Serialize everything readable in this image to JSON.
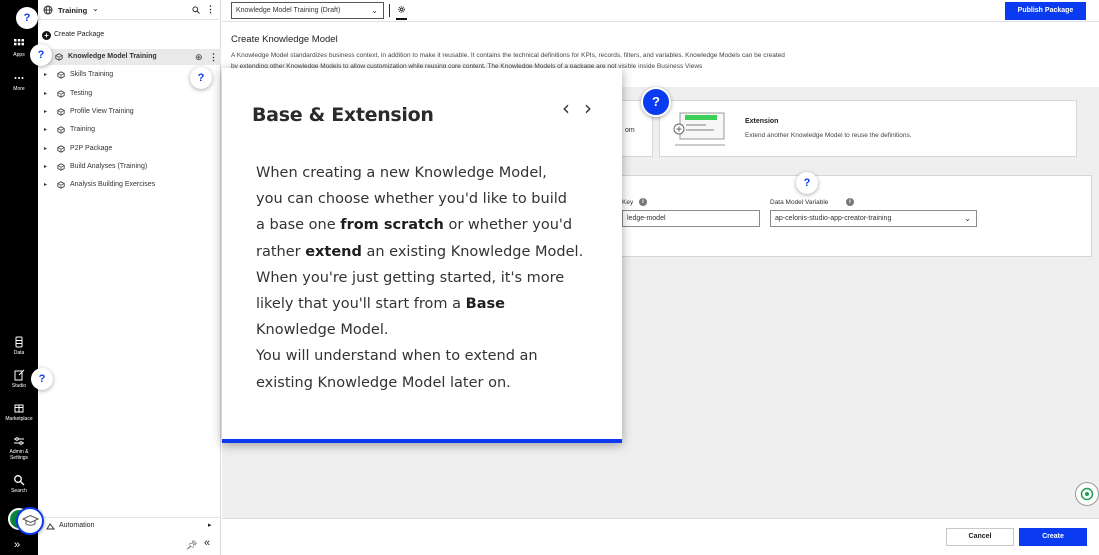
{
  "rail": {
    "items": [
      {
        "label": "Apps",
        "icon": "apps-grid-icon"
      },
      {
        "label": "More",
        "icon": "more-dots-icon"
      },
      {
        "label": "Data",
        "icon": "data-icon"
      },
      {
        "label": "Studio",
        "icon": "studio-icon"
      },
      {
        "label": "Marketplace",
        "icon": "marketplace-icon"
      },
      {
        "label": "Admin &",
        "label2": "Settings",
        "icon": "admin-settings-icon"
      },
      {
        "label": "Search",
        "icon": "search-icon"
      }
    ]
  },
  "sidebar": {
    "space_name": "Training",
    "create_package": "Create Package",
    "tree": [
      {
        "label": "Knowledge Model Training",
        "level": 1,
        "selected": true
      },
      {
        "label": "Skills Training",
        "level": 2
      },
      {
        "label": "Testing",
        "level": 2
      },
      {
        "label": "Profile View Training",
        "level": 2
      },
      {
        "label": "Training",
        "level": 2
      },
      {
        "label": "P2P Package",
        "level": 2
      },
      {
        "label": "Build Analyses (Training)",
        "level": 2
      },
      {
        "label": "Analysis Building Exercises",
        "level": 2
      }
    ],
    "automation": "Automation"
  },
  "topbar": {
    "package_select": "Knowledge Model Training (Draft)",
    "publish": "Publish Package"
  },
  "page": {
    "title": "Create Knowledge Model",
    "description_line1": "A Knowledge Model standardizes business context, in addition to make it reusable. It contains the technical definitions for KPIs, records, filters, and variables. Knowledge Models can be created",
    "description_line2": "by extending other Knowledge Models to allow customization while reusing core content. The Knowledge Models of a package are not visible inside Business Views",
    "base_option_fragment": "om",
    "extension_title": "Extension",
    "extension_desc": "Extend another Knowledge Model to reuse the definitions.",
    "key_label": "Key",
    "key_value": "ledge-model",
    "dmv_label": "Data Model Variable",
    "dmv_value": "ap-celonis-studio-app-creator-training"
  },
  "footer": {
    "cancel": "Cancel",
    "create": "Create"
  },
  "tooltip": {
    "title": "Base & Extension",
    "l1": "When creating a new Knowledge Model,",
    "l2": "you can choose whether you'd like to build",
    "l3a": "a base one ",
    "l3b": "from scratch",
    "l3c": " or whether you'd",
    "l4a": "rather ",
    "l4b": "extend",
    "l4c": " an existing Knowledge Model.",
    "l5": "When you're just getting started, it's more",
    "l6a": "likely that you'll start from a ",
    "l6b": "Base",
    "l7": "Knowledge Model.",
    "l8": "You will understand when to extend an",
    "l9": "existing Knowledge Model later on.",
    "prev": "‹",
    "next": "›"
  },
  "help": {
    "q": "?"
  },
  "colors": {
    "accent": "#0b3bf0",
    "rail": "#000000"
  }
}
